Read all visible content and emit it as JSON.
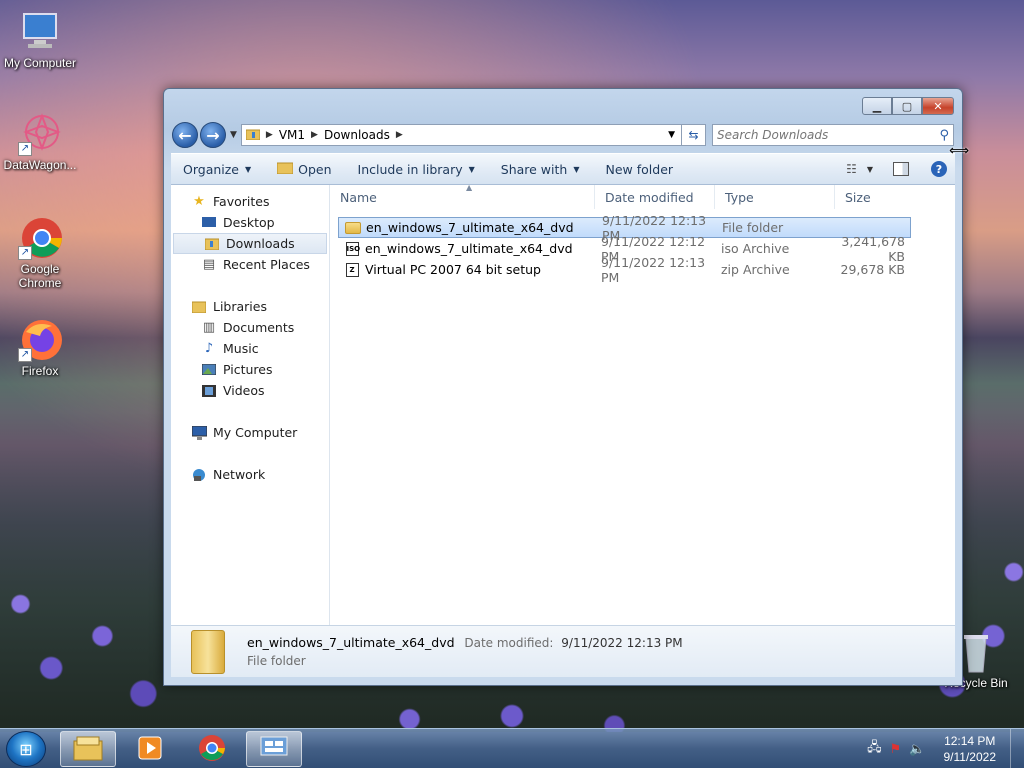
{
  "desktop": {
    "icons": [
      {
        "label": "My Computer"
      },
      {
        "label": "DataWagon..."
      },
      {
        "label": "Google Chrome"
      },
      {
        "label": "Firefox"
      },
      {
        "label": "Recycle Bin"
      }
    ]
  },
  "window": {
    "address": {
      "segments": [
        "VM1",
        "Downloads"
      ]
    },
    "search": {
      "placeholder": "Search Downloads"
    },
    "toolbar": {
      "organize": "Organize",
      "open": "Open",
      "include_in_library": "Include in library",
      "share_with": "Share with",
      "new_folder": "New folder"
    },
    "nav": {
      "favorites": "Favorites",
      "desktop": "Desktop",
      "downloads": "Downloads",
      "recent_places": "Recent Places",
      "libraries": "Libraries",
      "documents": "Documents",
      "music": "Music",
      "pictures": "Pictures",
      "videos": "Videos",
      "my_computer": "My Computer",
      "network": "Network"
    },
    "columns": {
      "name": "Name",
      "date_modified": "Date modified",
      "type": "Type",
      "size": "Size"
    },
    "files": [
      {
        "name": "en_windows_7_ultimate_x64_dvd",
        "date": "9/11/2022 12:13 PM",
        "type": "File folder",
        "size": "",
        "icon": "folder-icon"
      },
      {
        "name": "en_windows_7_ultimate_x64_dvd",
        "date": "9/11/2022 12:12 PM",
        "type": "iso Archive",
        "size": "3,241,678 KB",
        "icon": "iso-archive-icon"
      },
      {
        "name": "Virtual PC 2007 64 bit setup",
        "date": "9/11/2022 12:13 PM",
        "type": "zip Archive",
        "size": "29,678 KB",
        "icon": "zip-archive-icon"
      }
    ],
    "details": {
      "name": "en_windows_7_ultimate_x64_dvd",
      "date_label": "Date modified:",
      "date_value": "9/11/2022 12:13 PM",
      "type": "File folder"
    }
  },
  "taskbar": {
    "clock_time": "12:14 PM",
    "clock_date": "9/11/2022"
  }
}
